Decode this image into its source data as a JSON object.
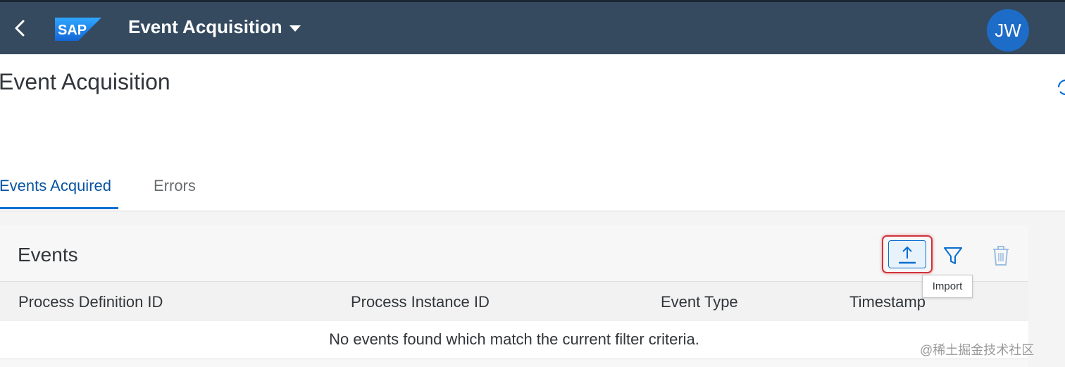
{
  "shell": {
    "logo_text": "SAP",
    "app_title": "Event Acquisition",
    "avatar_initials": "JW"
  },
  "page": {
    "title": "Event Acquisition"
  },
  "tabs": [
    {
      "label": "Events Acquired",
      "selected": true
    },
    {
      "label": "Errors",
      "selected": false
    }
  ],
  "events": {
    "title": "Events",
    "toolbar": {
      "import_tooltip": "Import"
    },
    "columns": [
      "Process Definition ID",
      "Process Instance ID",
      "Event Type",
      "Timestamp"
    ],
    "empty_message": "No events found which match the current filter criteria."
  },
  "watermark": "@稀土掘金技术社区",
  "colors": {
    "shell_bg": "#354a5f",
    "accent": "#0a6ed1",
    "highlight": "#d1333a"
  }
}
